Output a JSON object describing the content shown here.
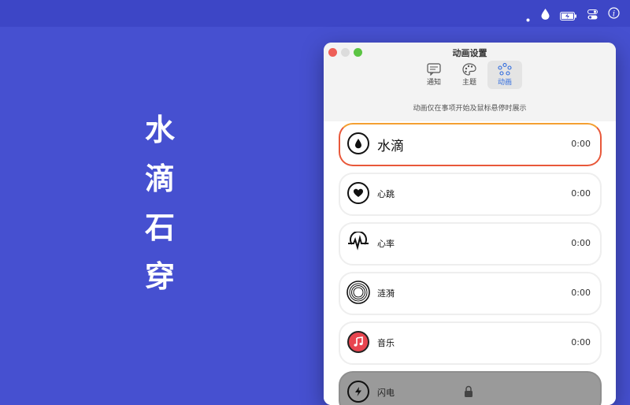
{
  "menubar": {
    "icons": [
      "dot-icon",
      "water-drop-icon",
      "battery-charging-icon",
      "control-center-icon",
      "info-icon"
    ]
  },
  "hero": {
    "chars": [
      "水",
      "滴",
      "石",
      "穿"
    ]
  },
  "window": {
    "title": "动画设置",
    "tabs": [
      {
        "label": "通知",
        "icon": "message-icon"
      },
      {
        "label": "主题",
        "icon": "palette-icon"
      },
      {
        "label": "动画",
        "icon": "animation-icon",
        "active": true
      }
    ],
    "subtitle": "动画仅在事项开始及鼠标悬停时展示",
    "animations": [
      {
        "name": "水滴",
        "time": "0:00",
        "icon": "water-drop-icon",
        "selected": true
      },
      {
        "name": "心跳",
        "time": "0:00",
        "icon": "heart-icon"
      },
      {
        "name": "心率",
        "time": "0:00",
        "icon": "heart-rate-icon"
      },
      {
        "name": "涟漪",
        "time": "0:00",
        "icon": "ripple-icon"
      },
      {
        "name": "音乐",
        "time": "0:00",
        "icon": "music-note-icon"
      },
      {
        "name": "闪电",
        "time": "",
        "icon": "lightning-icon",
        "locked": true
      }
    ]
  },
  "colors": {
    "background": "#4650d0",
    "accent": "#2f6bde",
    "selected_border": "#e8583a",
    "music_icon": "#e8454f"
  }
}
